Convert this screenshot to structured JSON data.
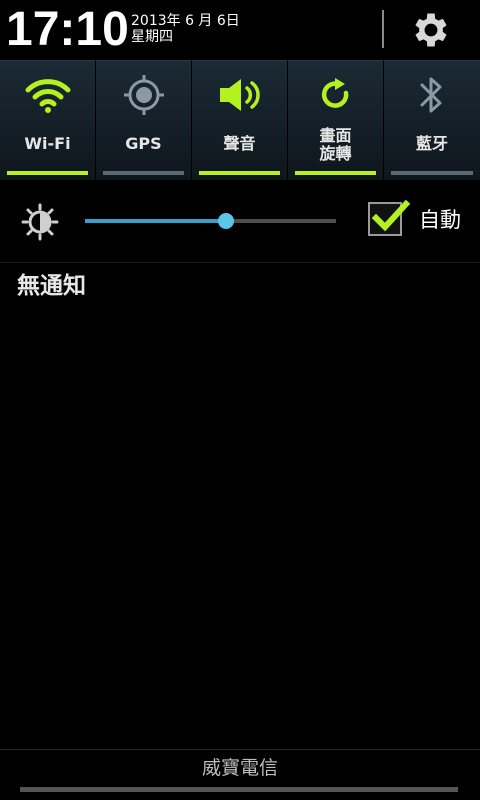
{
  "header": {
    "time": "17:10",
    "date_line1": "2013年 6 月 6日",
    "date_line2": "星期四",
    "settings_icon": "gear-icon"
  },
  "toggles": [
    {
      "label": "Wi-Fi",
      "icon": "wifi-icon",
      "on": true
    },
    {
      "label": "GPS",
      "icon": "gps-icon",
      "on": false
    },
    {
      "label": "聲音",
      "icon": "speaker-icon",
      "on": true
    },
    {
      "label_line1": "畫面",
      "label_line2": "旋轉",
      "icon": "rotate-icon",
      "on": true
    },
    {
      "label": "藍牙",
      "icon": "bluetooth-icon",
      "on": false
    }
  ],
  "brightness": {
    "icon": "brightness-icon",
    "level": 0.56,
    "auto_checked": true,
    "auto_label": "自動"
  },
  "notifications": {
    "empty_text": "無通知"
  },
  "footer": {
    "carrier": "威寶電信"
  },
  "colors": {
    "accent_green": "#b3f220",
    "inactive_bar": "#5a6a73",
    "slider_blue": "#3aa0c9"
  }
}
